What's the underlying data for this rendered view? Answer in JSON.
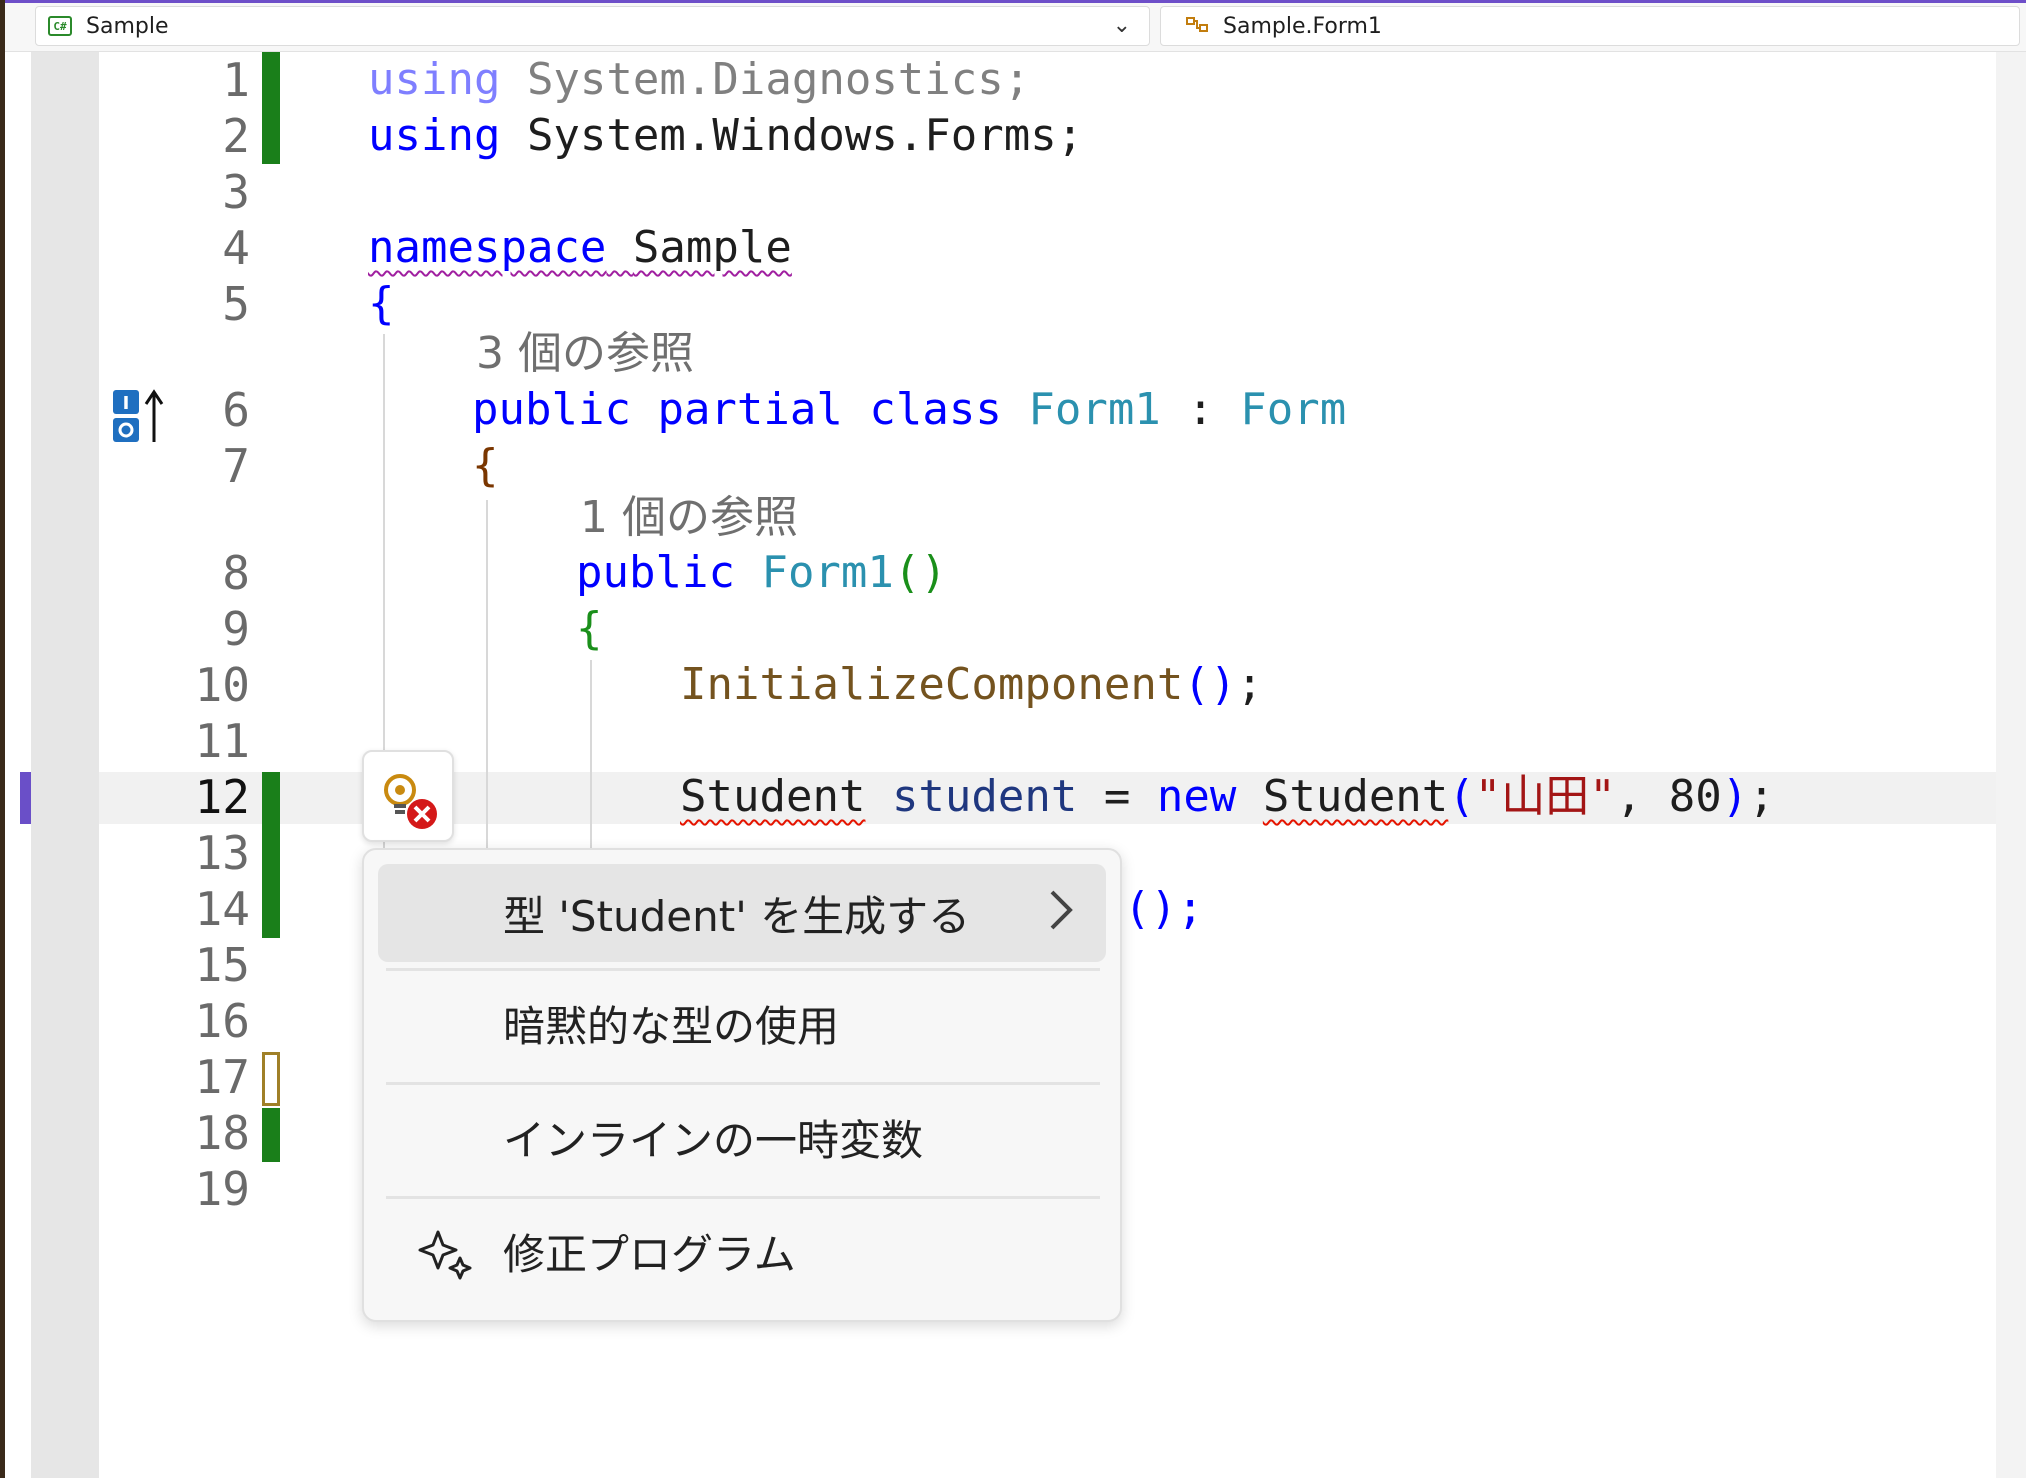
{
  "navbar": {
    "project_icon": "csharp-project-icon",
    "project": "Sample",
    "class_icon": "class-icon",
    "class": "Sample.Form1"
  },
  "line_numbers": [
    "1",
    "2",
    "3",
    "4",
    "5",
    "6",
    "7",
    "8",
    "9",
    "10",
    "11",
    "12",
    "13",
    "14",
    "15",
    "16",
    "17",
    "18",
    "19"
  ],
  "current_line": "12",
  "code": {
    "l1": {
      "kw": "using",
      "rest": " System.Diagnostics;"
    },
    "l2": {
      "kw": "using",
      "rest": " System.Windows.Forms;"
    },
    "l4": {
      "kw": "namespace",
      "name": "Sample"
    },
    "l5": {
      "brace": "{"
    },
    "lens1": "3 個の参照",
    "l6": {
      "kw1": "public",
      "kw2": "partial",
      "kw3": "class",
      "name": "Form1",
      "colon": ":",
      "base": "Form"
    },
    "l7": {
      "brace": "{"
    },
    "lens2": "1 個の参照",
    "l8": {
      "kw": "public",
      "name": "Form1",
      "parens": "()"
    },
    "l9": {
      "brace": "{"
    },
    "l10": {
      "method": "InitializeComponent",
      "parens": "()",
      "semi": ";"
    },
    "l12": {
      "type1": "Student",
      "var": "student",
      "eq": "=",
      "kw": "new",
      "type2": "Student",
      "open": "(",
      "str": "\"山田\"",
      "comma": ",",
      "num": "80",
      "close": ")",
      "semi": ";"
    },
    "l14_tail": "();"
  },
  "lightbulb": {
    "icon": "lightbulb-error-icon"
  },
  "quick_actions": [
    {
      "label": "型 'Student' を生成する",
      "has_submenu": true,
      "icon": ""
    },
    {
      "label": "暗黙的な型の使用",
      "has_submenu": false,
      "icon": ""
    },
    {
      "label": "インラインの一時変数",
      "has_submenu": false,
      "icon": ""
    },
    {
      "label": "修正プログラム",
      "has_submenu": false,
      "icon": "copilot-sparkle-icon"
    }
  ],
  "colors": {
    "keyword": "#0000ff",
    "type": "#2b91af",
    "method": "#74531f",
    "string": "#a31515",
    "change_saved": "#1a7f1a",
    "current_line_marker": "#6a4fc8"
  }
}
